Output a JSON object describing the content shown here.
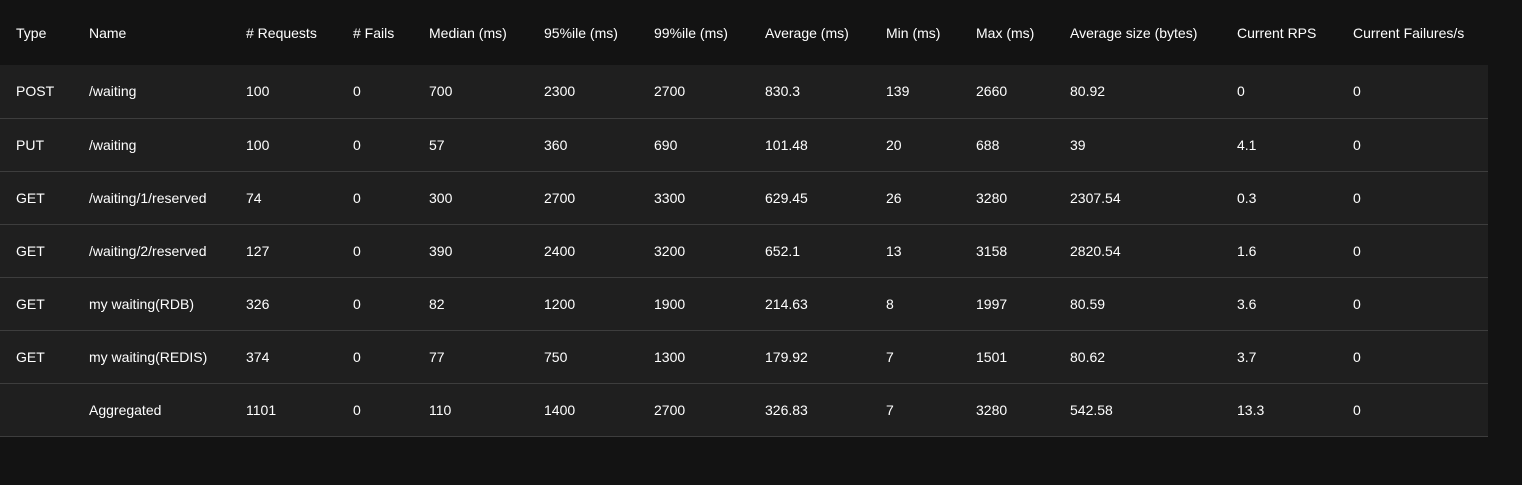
{
  "table": {
    "headers": [
      "Type",
      "Name",
      "# Requests",
      "# Fails",
      "Median (ms)",
      "95%ile (ms)",
      "99%ile (ms)",
      "Average (ms)",
      "Min (ms)",
      "Max (ms)",
      "Average size (bytes)",
      "Current RPS",
      "Current Failures/s"
    ],
    "rows": [
      [
        "POST",
        "/waiting",
        "100",
        "0",
        "700",
        "2300",
        "2700",
        "830.3",
        "139",
        "2660",
        "80.92",
        "0",
        "0"
      ],
      [
        "PUT",
        "/waiting",
        "100",
        "0",
        "57",
        "360",
        "690",
        "101.48",
        "20",
        "688",
        "39",
        "4.1",
        "0"
      ],
      [
        "GET",
        "/waiting/1/reserved",
        "74",
        "0",
        "300",
        "2700",
        "3300",
        "629.45",
        "26",
        "3280",
        "2307.54",
        "0.3",
        "0"
      ],
      [
        "GET",
        "/waiting/2/reserved",
        "127",
        "0",
        "390",
        "2400",
        "3200",
        "652.1",
        "13",
        "3158",
        "2820.54",
        "1.6",
        "0"
      ],
      [
        "GET",
        "my waiting(RDB)",
        "326",
        "0",
        "82",
        "1200",
        "1900",
        "214.63",
        "8",
        "1997",
        "80.59",
        "3.6",
        "0"
      ],
      [
        "GET",
        "my waiting(REDIS)",
        "374",
        "0",
        "77",
        "750",
        "1300",
        "179.92",
        "7",
        "1501",
        "80.62",
        "3.7",
        "0"
      ],
      [
        "",
        "Aggregated",
        "1101",
        "0",
        "110",
        "1400",
        "2700",
        "326.83",
        "7",
        "3280",
        "542.58",
        "13.3",
        "0"
      ]
    ]
  }
}
